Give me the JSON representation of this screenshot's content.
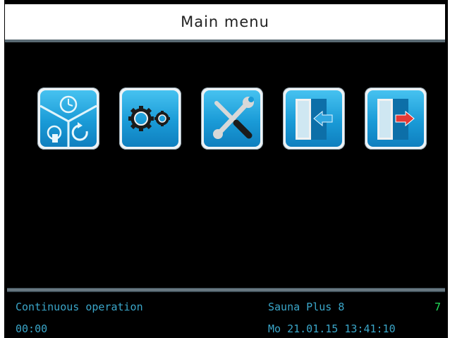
{
  "header": {
    "title": "Main menu"
  },
  "menu": {
    "items": [
      {
        "icon": "program-clock-icon"
      },
      {
        "icon": "gears-icon"
      },
      {
        "icon": "tools-icon"
      },
      {
        "icon": "door-enter-icon"
      },
      {
        "icon": "door-exit-icon"
      }
    ]
  },
  "status": {
    "mode": "Continuous operation",
    "device": "Sauna Plus 8",
    "level": "7",
    "timer": "00:00",
    "datetime": "Mo  21.01.15 13:41:10"
  },
  "colors": {
    "accent": "#1a9bd7",
    "status_text": "#3aa6c9",
    "level": "#22e05a"
  }
}
